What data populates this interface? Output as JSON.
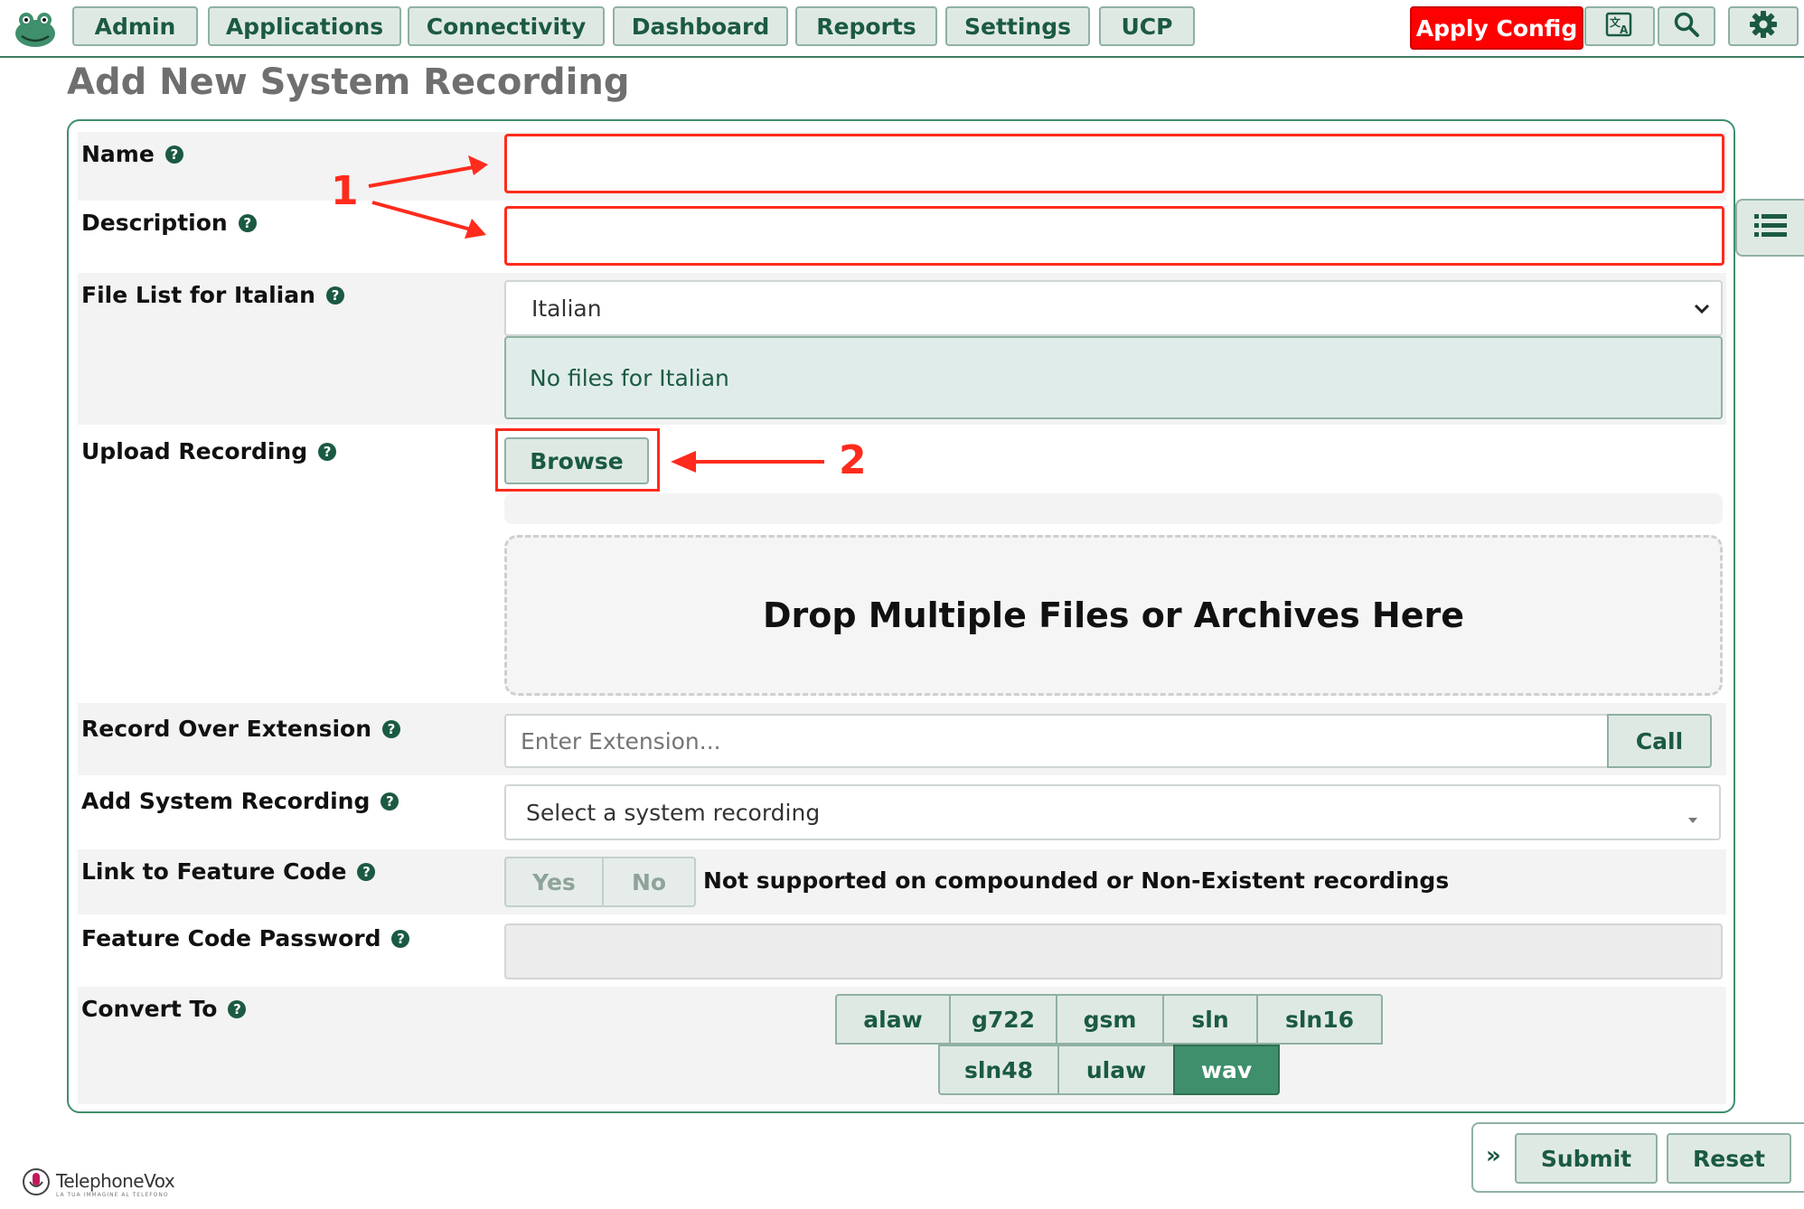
{
  "nav": {
    "items": [
      "Admin",
      "Applications",
      "Connectivity",
      "Dashboard",
      "Reports",
      "Settings",
      "UCP"
    ],
    "apply_label": "Apply Config"
  },
  "page": {
    "title": "Add New System Recording"
  },
  "form": {
    "name_label": "Name",
    "description_label": "Description",
    "file_list_label": "File List for Italian",
    "language_selected": "Italian",
    "no_files_text": "No files for Italian",
    "upload_label": "Upload Recording",
    "browse_label": "Browse",
    "dropzone_text": "Drop Multiple Files or Archives Here",
    "record_over_label": "Record Over Extension",
    "extension_placeholder": "Enter Extension...",
    "call_label": "Call",
    "add_system_label": "Add System Recording",
    "system_select_placeholder": "Select a system recording",
    "link_feature_label": "Link to Feature Code",
    "yes_label": "Yes",
    "no_label": "No",
    "link_note": "Not supported on compounded or Non-Existent recordings",
    "feature_password_label": "Feature Code Password",
    "convert_label": "Convert To",
    "formats_row1": [
      "alaw",
      "g722",
      "gsm",
      "sln",
      "sln16"
    ],
    "formats_row2": [
      "sln48",
      "ulaw",
      "wav"
    ],
    "active_format": "wav"
  },
  "annotations": {
    "one": "1",
    "two": "2"
  },
  "footer": {
    "submit_label": "Submit",
    "reset_label": "Reset",
    "expand_glyph": "»",
    "brand": "TelephoneVox",
    "tagline": "LA TUA IMMAGINE AL TELEFONO"
  },
  "colors": {
    "accent": "#1b5a42",
    "apply": "#ff0000",
    "annotation": "#ff2b1c"
  },
  "icons": [
    "frog-logo-icon",
    "translate-icon",
    "search-icon",
    "gear-icon",
    "list-icon",
    "help-icon",
    "chevron-down-icon"
  ]
}
